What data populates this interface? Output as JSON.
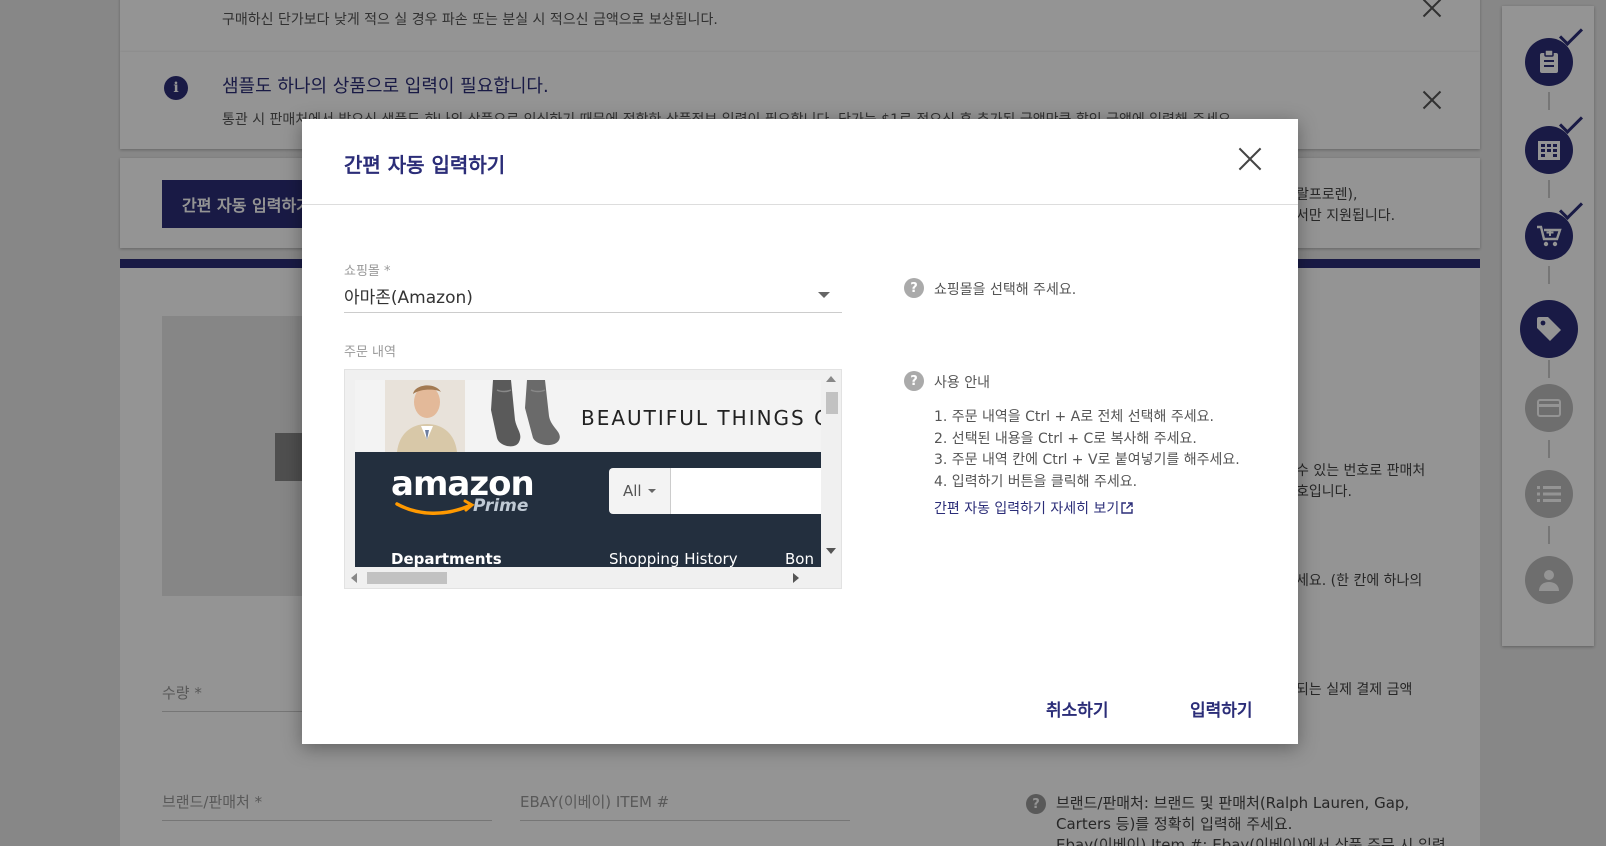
{
  "background": {
    "notice1": {
      "line": "구매하신 단가보다 낮게 적으 실 경우 파손 또는 분실 시 적으신 금액으로 보상됩니다."
    },
    "notice2": {
      "title": "샘플도 하나의 상품으로 입력이 필요합니다.",
      "line": "통관 시 판매처에서 발으신 샘플도 하나의 상품으로 인식하기 때문에 적합한 상품정보 입력이 필요합니다. 단가는 $1로 적으신 후 추가된 금액만큼 할인 금액에 입력해 주세요."
    },
    "auto_button_label": "간편 자동 입력하기",
    "side_texts": {
      "t1": "랄프로렌),",
      "t2": "서만 지원됩니다.",
      "t3": "수 있는 번호로 판매처",
      "t4": "호입니다.",
      "t5": "세요. (한 칸에 하나의",
      "t6": "되는 실제 결제 금액"
    },
    "fields": {
      "quantity_label": "수량 *",
      "brand_label": "브랜드/판매처 *",
      "ebay_label": "EBAY(이베이) ITEM #"
    },
    "brand_help": {
      "line1": "브랜드/판매처: 브랜드 및 판매처(Ralph Lauren, Gap,",
      "line2": "Carters 등)를 정확히 입력해 주세요.",
      "line3": "Ebay(이베이) Item #: Ebay(이베이)에서 상품 주문 시 입력"
    }
  },
  "sidebar": {
    "steps": [
      {
        "icon": "clipboard-icon",
        "state": "done"
      },
      {
        "icon": "building-icon",
        "state": "done"
      },
      {
        "icon": "cart-add-icon",
        "state": "done"
      },
      {
        "icon": "tag-icon",
        "state": "active"
      },
      {
        "icon": "card-icon",
        "state": "todo"
      },
      {
        "icon": "list-icon",
        "state": "todo"
      },
      {
        "icon": "person-icon",
        "state": "todo"
      }
    ]
  },
  "modal": {
    "title": "간편 자동 입력하기",
    "mall_label": "쇼핑몰 *",
    "mall_value": "아마존(Amazon)",
    "order_label": "주문 내역",
    "preview": {
      "banner_text": "BEAUTIFUL THINGS C",
      "logo": "amazon",
      "prime": "Prime",
      "all_label": "All",
      "nav1": "Departments",
      "nav2": "Shopping History",
      "nav3": "Bon"
    },
    "mall_help": "쇼핑몰을 선택해 주세요.",
    "guide_title": "사용 안내",
    "guide_steps": [
      "1. 주문 내역을 Ctrl + A로 전체 선택해 주세요.",
      "2. 선택된 내용을 Ctrl + C로 복사해 주세요.",
      "3. 주문 내역 칸에 Ctrl + V로 붙여넣기를 해주세요.",
      "4. 입력하기 버튼을 클릭해 주세요."
    ],
    "guide_link": "간편 자동 입력하기 자세히 보기",
    "cancel_label": "취소하기",
    "submit_label": "입력하기"
  },
  "colors": {
    "brand_navy": "#2b2d78",
    "amazon_dark": "#232f3e",
    "amazon_orange": "#ff9900"
  }
}
